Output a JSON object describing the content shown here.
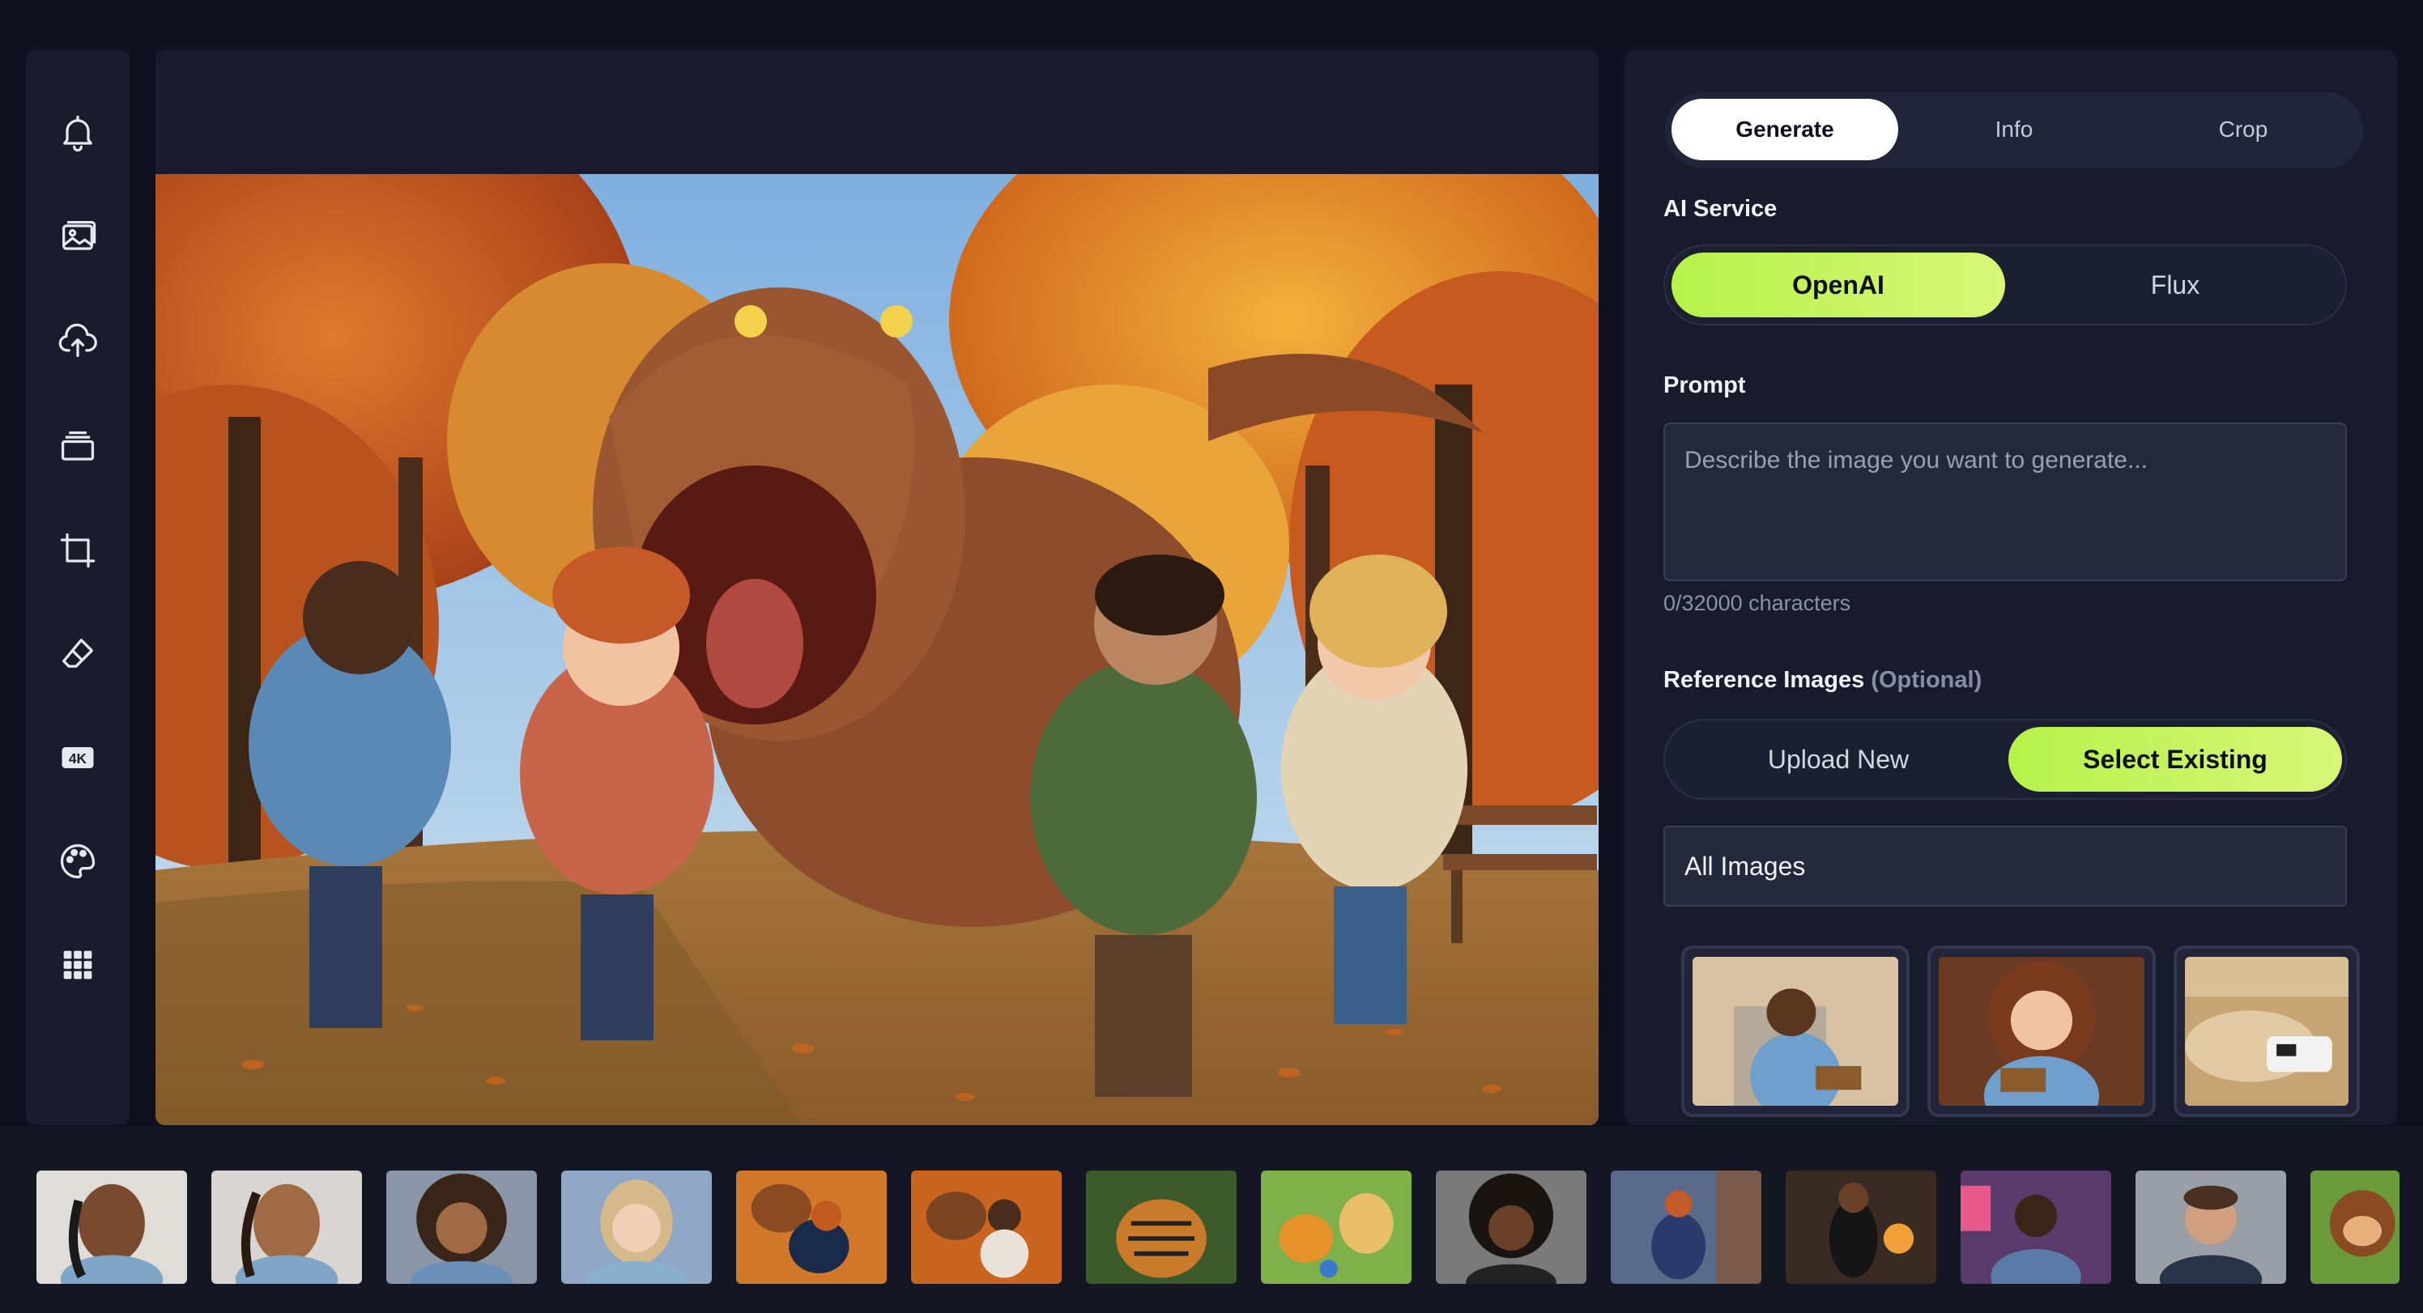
{
  "sidebar": {
    "items": [
      {
        "icon": "bell-icon"
      },
      {
        "icon": "image-gallery-icon"
      },
      {
        "icon": "cloud-upload-icon"
      },
      {
        "icon": "layers-icon"
      },
      {
        "icon": "crop-icon"
      },
      {
        "icon": "eraser-icon"
      },
      {
        "icon": "upscale-4k-icon",
        "badge": "4K"
      },
      {
        "icon": "palette-icon"
      },
      {
        "icon": "grid-icon"
      }
    ]
  },
  "panel": {
    "tabs": [
      "Generate",
      "Info",
      "Crop"
    ],
    "active_tab": "Generate",
    "ai_service": {
      "label": "AI Service",
      "options": [
        "OpenAI",
        "Flux"
      ],
      "selected": "OpenAI"
    },
    "prompt": {
      "label": "Prompt",
      "placeholder": "Describe the image you want to generate...",
      "value": "",
      "char_count": "0/32000 characters"
    },
    "reference": {
      "label": "Reference Images",
      "optional": "(Optional)",
      "options": [
        "Upload New",
        "Select Existing"
      ],
      "selected": "Select Existing",
      "filter_value": "All Images"
    }
  },
  "colors": {
    "accent_green": "#c4f45e",
    "panel_bg": "#191b2c",
    "page_bg": "#0f1120"
  }
}
